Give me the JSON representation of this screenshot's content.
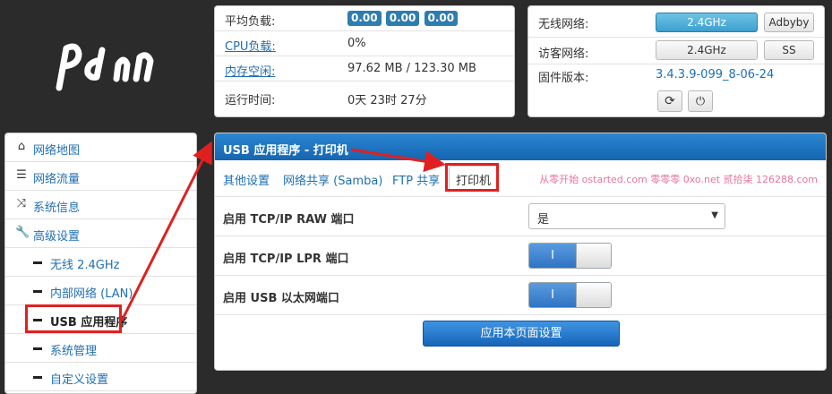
{
  "logo": {
    "name": "pdan-logo"
  },
  "stats": {
    "load_label": "平均负载:",
    "load_values": [
      "0.00",
      "0.00",
      "0.00"
    ],
    "cpu_label": "CPU负载:",
    "cpu_value": "0%",
    "mem_label": "内存空闲:",
    "mem_value": "97.62 MB / 123.30 MB",
    "uptime_label": "运行时间:",
    "uptime_value": "0天 23时 27分"
  },
  "status": {
    "wireless_label": "无线网络:",
    "wireless_btn": "2.4GHz",
    "wireless_ssid": "Adbyby",
    "guest_label": "访客网络:",
    "guest_btn": "2.4GHz",
    "guest_ssid": "SS",
    "firmware_label": "固件版本:",
    "firmware_value": "3.4.3.9-099_8-06-24",
    "refresh_icon": "refresh-icon",
    "power_icon": "power-icon"
  },
  "sidebar": {
    "items": [
      {
        "label": "网络地图",
        "icon": "home-icon"
      },
      {
        "label": "网络流量",
        "icon": "traffic-icon"
      },
      {
        "label": "系统信息",
        "icon": "shuffle-icon"
      },
      {
        "label": "高级设置",
        "icon": "wrench-icon"
      },
      {
        "label": "无线 2.4GHz"
      },
      {
        "label": "内部网络 (LAN)"
      },
      {
        "label": "USB 应用程序"
      },
      {
        "label": "系统管理"
      },
      {
        "label": "自定义设置"
      }
    ]
  },
  "main": {
    "title": "USB 应用程序 - 打印机",
    "tabs": [
      "其他设置",
      "网络共享 (Samba)",
      "FTP 共享",
      "打印机"
    ],
    "watermark": "从零开始 ostarted.com 零零零 0xo.net 贰拾柒 126288.com",
    "fields": [
      {
        "label": "启用 TCP/IP RAW 端口",
        "value": "是"
      },
      {
        "label": "启用 TCP/IP LPR 端口",
        "toggle_text": "I"
      },
      {
        "label": "启用 USB 以太网端口",
        "toggle_text": "I"
      }
    ],
    "apply_label": "应用本页面设置"
  },
  "colors": {
    "page_bg": "#2b2b2b",
    "header_blue": "#1f78c8",
    "link_blue": "#1f6fb2",
    "badge_blue": "#2d7db0",
    "highlight_red": "#e02020"
  }
}
